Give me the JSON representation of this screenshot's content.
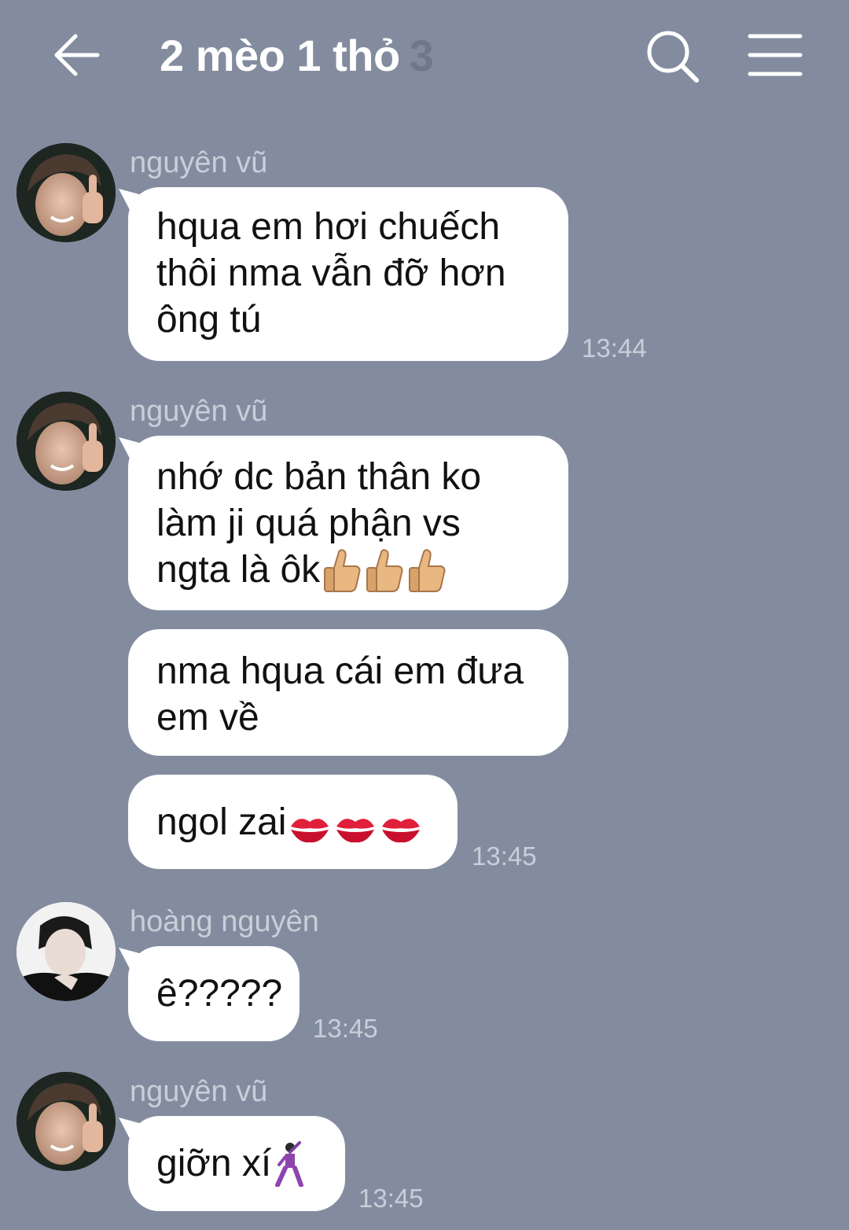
{
  "header": {
    "back_icon": "arrow-left-icon",
    "title": "2 mèo 1 thỏ",
    "member_count": "3",
    "search_icon": "search-icon",
    "menu_icon": "hamburger-menu-icon"
  },
  "colors": {
    "background": "#838c9f",
    "bubble": "#ffffff",
    "meta_text": "#c9ced8"
  },
  "messages": [
    {
      "sender": "nguyên vũ",
      "text": "hqua em hơi chuếch\nthôi nma vẫn đỡ hơn\nông tú",
      "time": "13:44"
    },
    {
      "sender": "nguyên vũ",
      "text": "nhớ dc bản thân ko\nlàm ji quá phận vs\nngta là ôk",
      "emoji": [
        "thumbs-up",
        "thumbs-up",
        "thumbs-up"
      ]
    },
    {
      "text": "nma hqua cái em đưa\nem về"
    },
    {
      "text": "ngol zai",
      "emoji": [
        "kiss-mark",
        "kiss-mark",
        "kiss-mark"
      ],
      "time": "13:45"
    },
    {
      "sender": "hoàng nguyên",
      "text": "ê?????",
      "time": "13:45"
    },
    {
      "sender": "nguyên vũ",
      "text": "giỡn xí",
      "emoji": [
        "dancer"
      ],
      "time": "13:45"
    }
  ]
}
